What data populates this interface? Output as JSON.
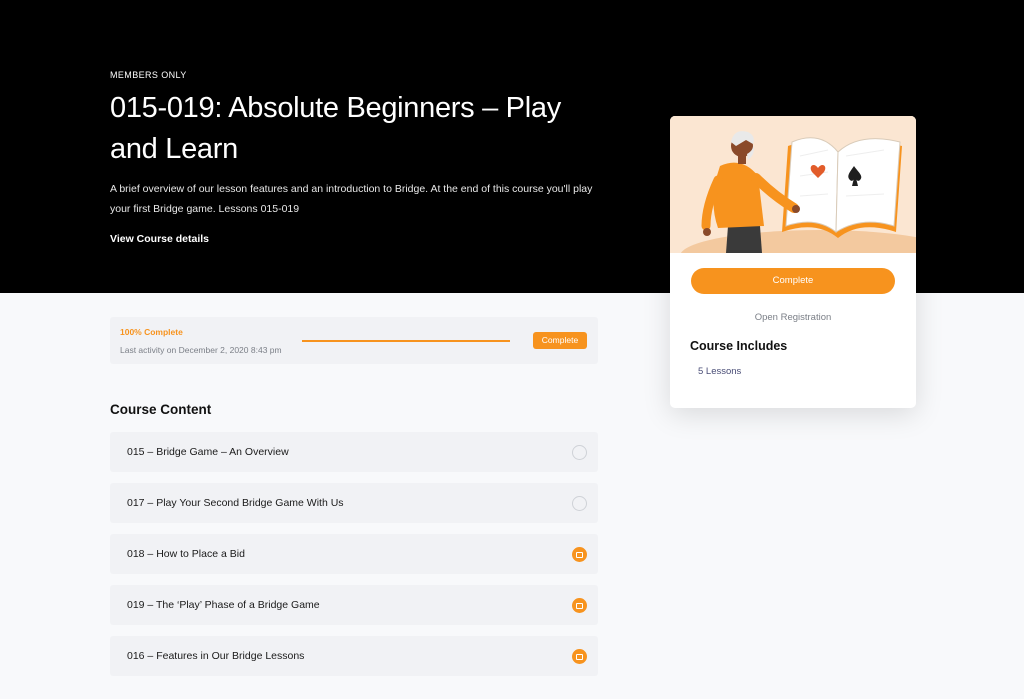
{
  "hero": {
    "eyebrow": "MEMBERS ONLY",
    "title": "015-019: Absolute Beginners – Play and Learn",
    "description": "A brief overview of our lesson features and an introduction to Bridge. At the end of this course you'll play your first Bridge game. Lessons 015-019",
    "details_link": "View Course details"
  },
  "progress": {
    "percent_label": "100% Complete",
    "percent": 100,
    "last_activity": "Last activity on December 2, 2020 8:43 pm",
    "status": "Complete"
  },
  "course_content": {
    "title": "Course Content",
    "lessons": [
      {
        "title": "015 – Bridge Game – An Overview",
        "status": "not-started"
      },
      {
        "title": "017 – Play Your Second Bridge Game With Us",
        "status": "not-started"
      },
      {
        "title": "018 – How to Place a Bid",
        "status": "in-progress"
      },
      {
        "title": "019 – The ‘Play’ Phase of a Bridge Game",
        "status": "in-progress"
      },
      {
        "title": "016 – Features in Our Bridge Lessons",
        "status": "in-progress"
      }
    ]
  },
  "sidebar_card": {
    "button_label": "Complete",
    "registration": "Open Registration",
    "includes_title": "Course Includes",
    "includes_item": "5 Lessons"
  },
  "colors": {
    "accent": "#f7931e",
    "hero_bg": "#000000",
    "page_bg": "#f8f9fb",
    "row_bg": "#f1f2f5"
  }
}
